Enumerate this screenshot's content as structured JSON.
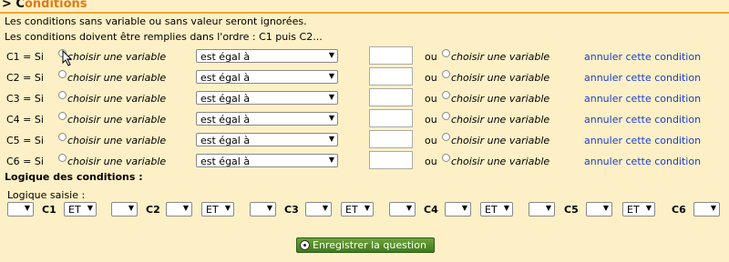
{
  "header": {
    "title_first": "> C",
    "title_rest": "onditions"
  },
  "intro": {
    "line1": "Les conditions sans variable ou sans valeur seront ignorées.",
    "line2": "Les conditions doivent être remplies dans l'ordre : C1 puis C2..."
  },
  "conditions": [
    {
      "label": "C1 = Si",
      "variable": "choisir une variable",
      "operator": "est égal à",
      "value": "",
      "ou": "ou",
      "variable2": "choisir une variable",
      "cancel": "annuler cette condition"
    },
    {
      "label": "C2 = Si",
      "variable": "choisir une variable",
      "operator": "est égal à",
      "value": "",
      "ou": "ou",
      "variable2": "choisir une variable",
      "cancel": "annuler cette condition"
    },
    {
      "label": "C3 = Si",
      "variable": "choisir une variable",
      "operator": "est égal à",
      "value": "",
      "ou": "ou",
      "variable2": "choisir une variable",
      "cancel": "annuler cette condition"
    },
    {
      "label": "C4 = Si",
      "variable": "choisir une variable",
      "operator": "est égal à",
      "value": "",
      "ou": "ou",
      "variable2": "choisir une variable",
      "cancel": "annuler cette condition"
    },
    {
      "label": "C5 = Si",
      "variable": "choisir une variable",
      "operator": "est égal à",
      "value": "",
      "ou": "ou",
      "variable2": "choisir une variable",
      "cancel": "annuler cette condition"
    },
    {
      "label": "C6 = Si",
      "variable": "choisir une variable",
      "operator": "est égal à",
      "value": "",
      "ou": "ou",
      "variable2": "choisir une variable",
      "cancel": "annuler cette condition"
    }
  ],
  "logic": {
    "title": "Logique des conditions :",
    "subtitle": "Logique saisie :",
    "labels": [
      "C1",
      "C2",
      "C3",
      "C4",
      "C5",
      "C6"
    ],
    "operators": [
      "ET",
      "ET",
      "ET",
      "ET",
      "ET"
    ],
    "paren_selects": [
      "",
      "",
      "",
      "",
      "",
      "",
      "",
      "",
      "",
      "",
      "",
      ""
    ]
  },
  "save_button": {
    "label": "Enregistrer la question",
    "icon": "soccer-ball-icon"
  },
  "colors": {
    "background": "#fdf0c6",
    "header_accent": "#f2a530",
    "title_accent": "#e07a10",
    "link": "#1a3fcc",
    "button": "#4f8a26"
  }
}
